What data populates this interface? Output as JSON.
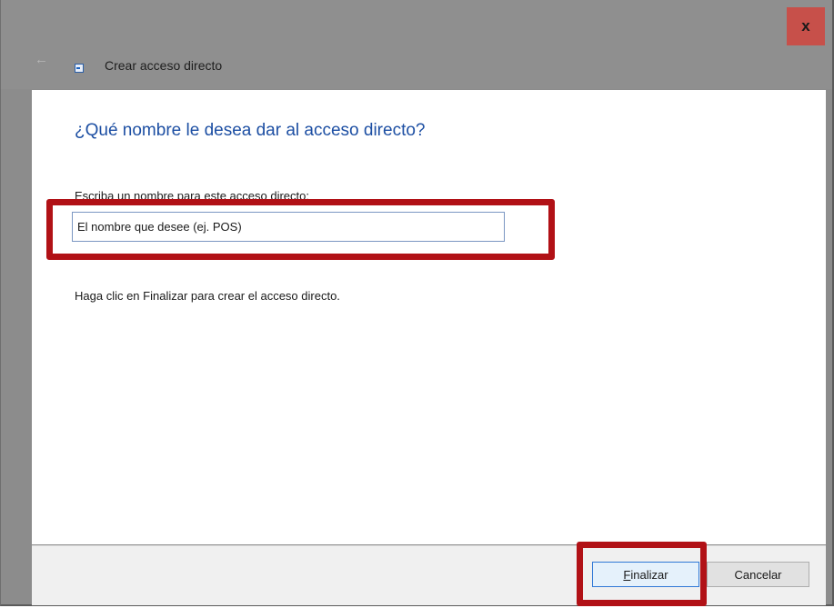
{
  "titlebar": {
    "close_label": "x",
    "back_icon": "back-arrow-icon",
    "app_icon": "shortcut-wizard-icon",
    "title": "Crear acceso directo"
  },
  "content": {
    "instruction": "¿Qué nombre le desea dar al acceso directo?",
    "name_label": "Escriba un nombre para este acceso directo:",
    "name_value": "El nombre que desee (ej. POS)",
    "finish_hint": "Haga clic en Finalizar para crear el acceso directo."
  },
  "buttons": {
    "finish_first_letter": "F",
    "finish_rest": "inalizar",
    "cancel": "Cancelar"
  },
  "colors": {
    "highlight": "#b11116",
    "instruction_text": "#1d4fa3",
    "close_button": "#c7504a"
  }
}
